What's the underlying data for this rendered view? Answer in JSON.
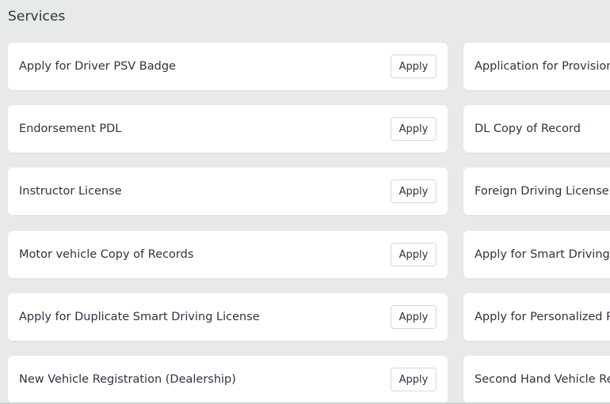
{
  "section": {
    "title": "Services"
  },
  "apply_label": "Apply",
  "left_cards": [
    {
      "label": "Apply for Driver PSV Badge",
      "button": "Apply"
    },
    {
      "label": "Endorsement PDL",
      "button": "Apply"
    },
    {
      "label": "Instructor License",
      "button": "Apply"
    },
    {
      "label": "Motor vehicle Copy of Records",
      "button": "Apply"
    },
    {
      "label": "Apply for Duplicate Smart Driving License",
      "button": "Apply"
    },
    {
      "label": "New Vehicle Registration (Dealership)",
      "button": "Apply"
    }
  ],
  "right_cards": [
    {
      "label": "Application for Provisiona"
    },
    {
      "label": "DL Copy of Record"
    },
    {
      "label": "Foreign Driving License C"
    },
    {
      "label": "Apply for Smart Driving L"
    },
    {
      "label": "Apply for Personalized Pla"
    },
    {
      "label": "Second Hand Vehicle Reg"
    }
  ]
}
